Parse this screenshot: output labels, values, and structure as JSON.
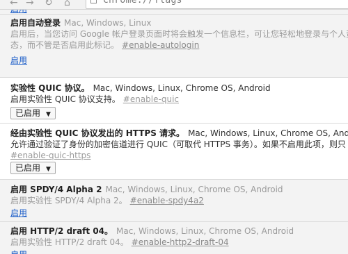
{
  "browser": {
    "url": "chrome://flags",
    "icons": {
      "back": "back-arrow-icon",
      "forward": "forward-arrow-icon",
      "reload": "reload-icon",
      "home": "home-icon",
      "page": "page-icon"
    }
  },
  "flags": [
    {
      "partial_link": "启用"
    },
    {
      "name": "启用自动登录",
      "platforms": "Mac, Windows, Linux",
      "desc_1": "启用后，当您访问 Google 帐户登录页面时将会触发一个信息栏，可让您轻松地登录与个人资料",
      "desc_2": "态，而不管是否启用此标记。",
      "anchor": "#enable-autologin",
      "action": "启用"
    },
    {
      "name": "实验性 QUIC 协议。",
      "platforms": "Mac, Windows, Linux, Chrome OS, Android",
      "desc_1": "启用实验性 QUIC 协议支持。",
      "anchor": "#enable-quic",
      "select": "已启用"
    },
    {
      "name": "经由实验性 QUIC 协议发出的 HTTPS 请求。",
      "platforms": "Mac, Windows, Linux, Chrome OS, Android",
      "desc_1": "允许通过验证了身份的加密信道进行 QUIC（可取代 HTTPS 事务）。如果不启用此项，则只",
      "anchor": "#enable-quic-https",
      "select": "已启用"
    },
    {
      "name": "启用 SPDY/4 Alpha 2",
      "platforms": "Mac, Windows, Linux, Chrome OS, Android",
      "desc_1": "启用实验性 SPDY/4 Alpha 2。",
      "anchor": "#enable-spdy4a2",
      "action": "启用"
    },
    {
      "name": "启用 HTTP/2 draft 04。",
      "platforms": "Mac, Windows, Linux, Chrome OS, Android",
      "desc_1": "启用实验性 HTTP/2 draft 04。",
      "anchor": "#enable-http2-draft-04",
      "action": "启用"
    }
  ],
  "colors": {
    "link": "#1a5cc8",
    "disabled_bg": "#f3f3f3",
    "enabled_bg": "#ffffff"
  }
}
